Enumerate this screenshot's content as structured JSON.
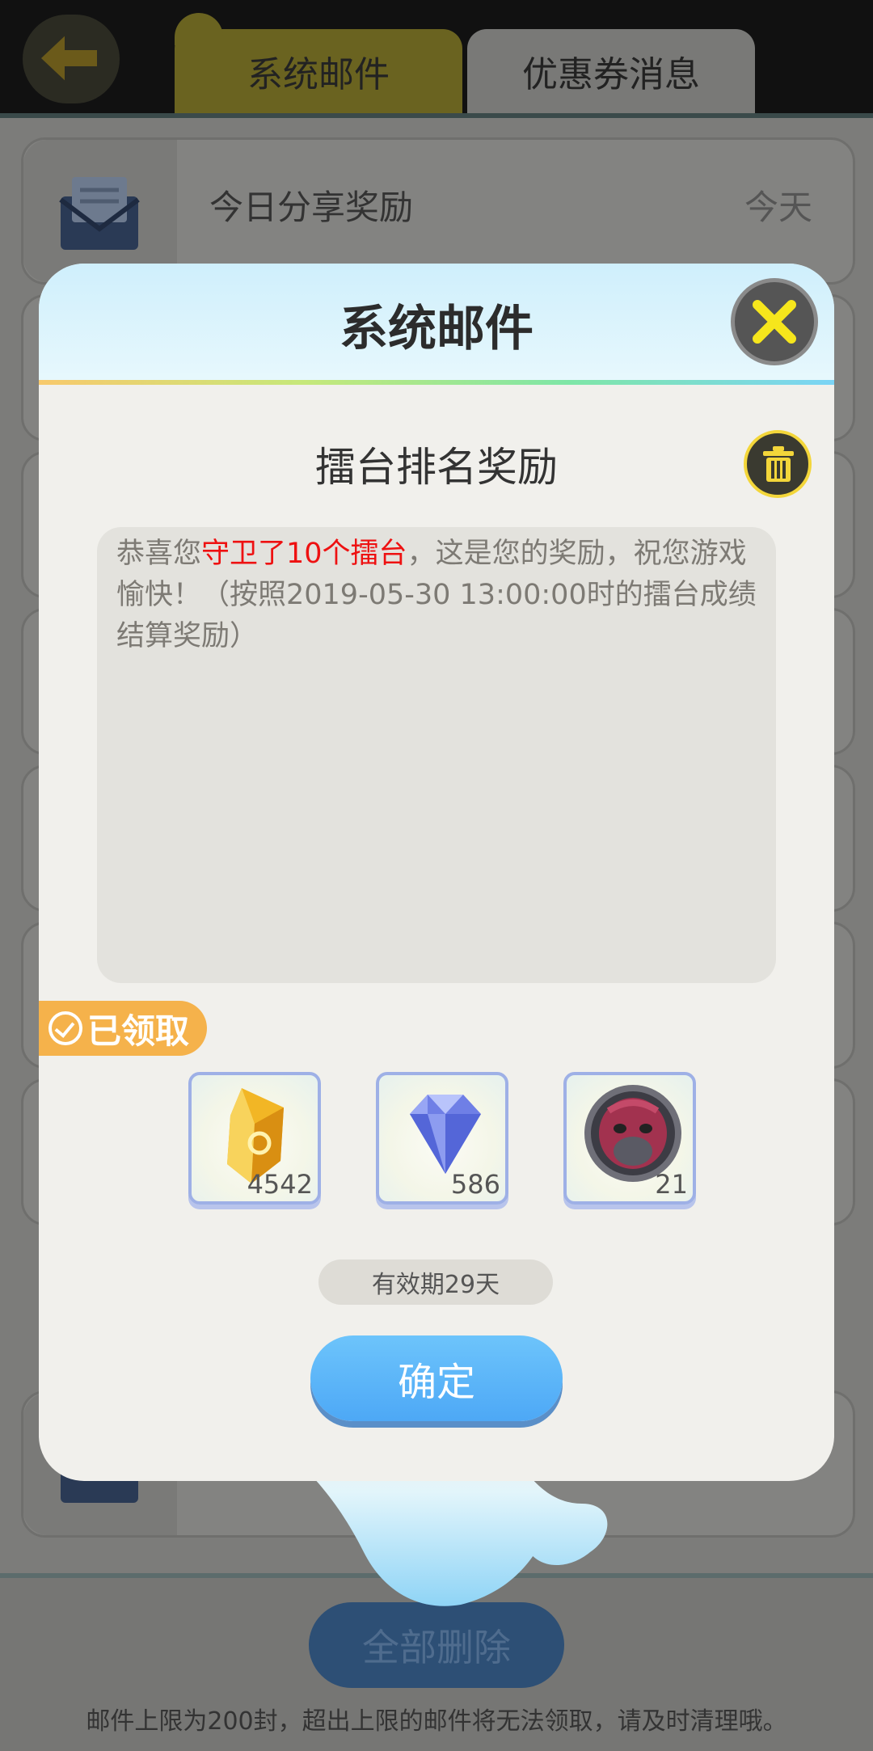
{
  "header": {
    "tabs": [
      {
        "label": "系统邮件",
        "active": true
      },
      {
        "label": "优惠券消息",
        "active": false
      }
    ]
  },
  "mail_list": {
    "items": [
      {
        "subject": "今日分享奖励",
        "date": "今天"
      }
    ]
  },
  "footer": {
    "delete_all_label": "全部删除",
    "note": "邮件上限为200封，超出上限的邮件将无法领取，请及时清理哦。"
  },
  "dialog": {
    "title": "系统邮件",
    "subject": "擂台排名奖励",
    "body_prefix": "恭喜您",
    "body_highlight": "守卫了10个擂台",
    "body_suffix": "，这是您的奖励，祝您游戏愉快！（按照2019-05-30 13:00:00时的擂台成绩结算奖励）",
    "claimed_label": "已领取",
    "rewards": [
      {
        "icon": "gold-crystal-icon",
        "count": "4542"
      },
      {
        "icon": "blue-diamond-icon",
        "count": "586"
      },
      {
        "icon": "monster-avatar-icon",
        "count": "21"
      }
    ],
    "validity": "有效期29天",
    "confirm_label": "确定"
  },
  "colors": {
    "highlight": "#ee1111",
    "claimed_badge": "#f5b24b",
    "confirm_button": "#4da8f6"
  }
}
